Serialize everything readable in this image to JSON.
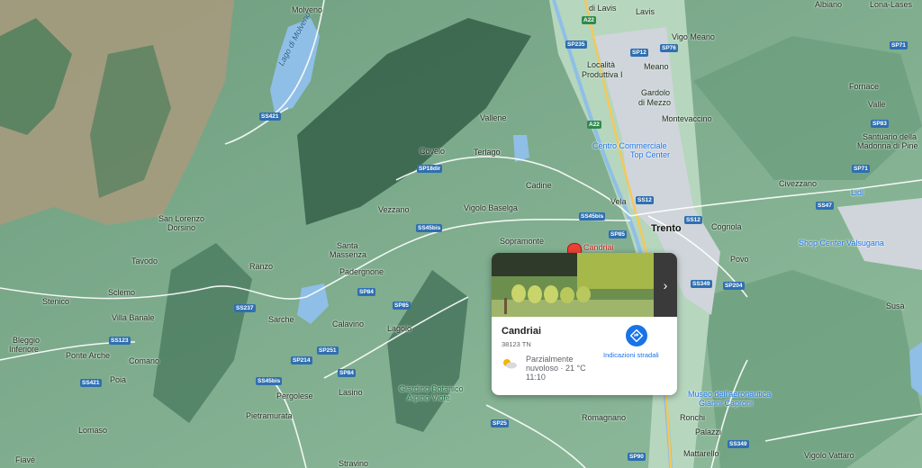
{
  "map": {
    "colors": {
      "base": "#7fae8e",
      "ridge": "#2f5b44",
      "valley": "#9ec8a8",
      "urban": "#c9cfd4",
      "lake": "#8fbfe6",
      "road": "#ffffff",
      "highway": "#f3c95a",
      "rock": "#b7a48c"
    },
    "labels": {
      "molveno": "Molveno",
      "lago_molveno": "Lago di Molveno",
      "lavis": "Lavis",
      "dilavis": "di Lavis",
      "albiano": "Albiano",
      "lona_lases": "Lona-Lases",
      "vigo_meano": "Vigo Meano",
      "meano": "Meano",
      "localita": "Località",
      "produttiva": "Produttiva I",
      "gardolo": "Gardolo",
      "di_mezzo": "di Mezzo",
      "fornace": "Fornace",
      "valle": "Valle",
      "montevaccino": "Montevaccino",
      "santuario1": "Santuario della",
      "santuario2": "Madonna di Pine",
      "vallene": "Vallene",
      "covelo": "Covelo",
      "terlago": "Terlago",
      "centro1": "Centro Commerciale",
      "centro2": "Top Center",
      "civezzano": "Civezzano",
      "lidl": "Lidl",
      "cadine": "Cadine",
      "vela": "Vela",
      "vezzano": "Vezzano",
      "vigolo_baselga": "Vigolo Baselga",
      "trento": "Trento",
      "cognola": "Cognola",
      "san_lorenzo": "San Lorenzo",
      "dorsino": "Dorsino",
      "sopramonte": "Sopramonte",
      "candriai_map": "Candriai",
      "shop_center": "Shop Center Valsugana",
      "santa": "Santa",
      "massenza": "Massenza",
      "tavodo": "Tavodo",
      "ranzo": "Ranzo",
      "padergnone": "Padergnone",
      "povo": "Povo",
      "stenico": "Stenico",
      "sclemo": "Sclemo",
      "villa_banale": "Villa Banale",
      "sarche": "Sarche",
      "calavino": "Calavino",
      "lagolo": "Lagolo",
      "susa": "Susà",
      "bleggio1": "Bleggio",
      "bleggio2": "Inferiore",
      "ponte_arche": "Ponte Arche",
      "comano": "Comano",
      "poia": "Poia",
      "museo1": "Museo dell'aeronautica",
      "museo2": "Gianni Caproni",
      "giardino1": "Giardino Botanico",
      "giardino2": "Alpino Viote",
      "pergolese": "Pergolese",
      "lasino": "Lasino",
      "pietramurata": "Pietramurata",
      "romagnano": "Romagnano",
      "ronchi": "Ronchi",
      "lomaso": "Lomaso",
      "palazzi": "Palazzi",
      "mattarello": "Mattarello",
      "vigolo_vattaro": "Vigolo Vattaro",
      "stravino": "Stravino",
      "fiave": "Fiavé"
    },
    "roads": {
      "ss421a": "SS421",
      "a22a": "A22",
      "sp235": "SP235",
      "sp76": "SP76",
      "sp12": "SP12",
      "a22b": "A22",
      "sp18dir": "SP18dir",
      "ss12": "SS12",
      "ss45bis_a": "SS45bis",
      "ss45bis_b": "SS45bis",
      "sp85a": "SP85",
      "ss349": "SS349",
      "sp204": "SP204",
      "sp84": "SP84",
      "sp85b": "SP85",
      "ss237": "SS237",
      "ss123": "SS123",
      "sp251": "SP251",
      "sp214": "SP214",
      "sp84b": "SP84",
      "ss45bis_c": "SS45bis",
      "ss421b": "SS421",
      "sp25": "SP25",
      "sp90": "SP90",
      "ss349b": "SS349",
      "ss47": "SS47",
      "sp71": "SP71",
      "sp83": "SP83",
      "sp71b": "SP71",
      "ss12b": "SS12"
    }
  },
  "place_card": {
    "name": "Candriai",
    "address": "38123 TN",
    "weather": "Parzialmente nuvoloso · 21 °C",
    "time": "11:10",
    "directions_label": "Indicazioni stradali",
    "next_icon": "chevron-right-icon",
    "weather_icon": "partly-cloudy-icon",
    "directions_icon": "directions-icon"
  }
}
